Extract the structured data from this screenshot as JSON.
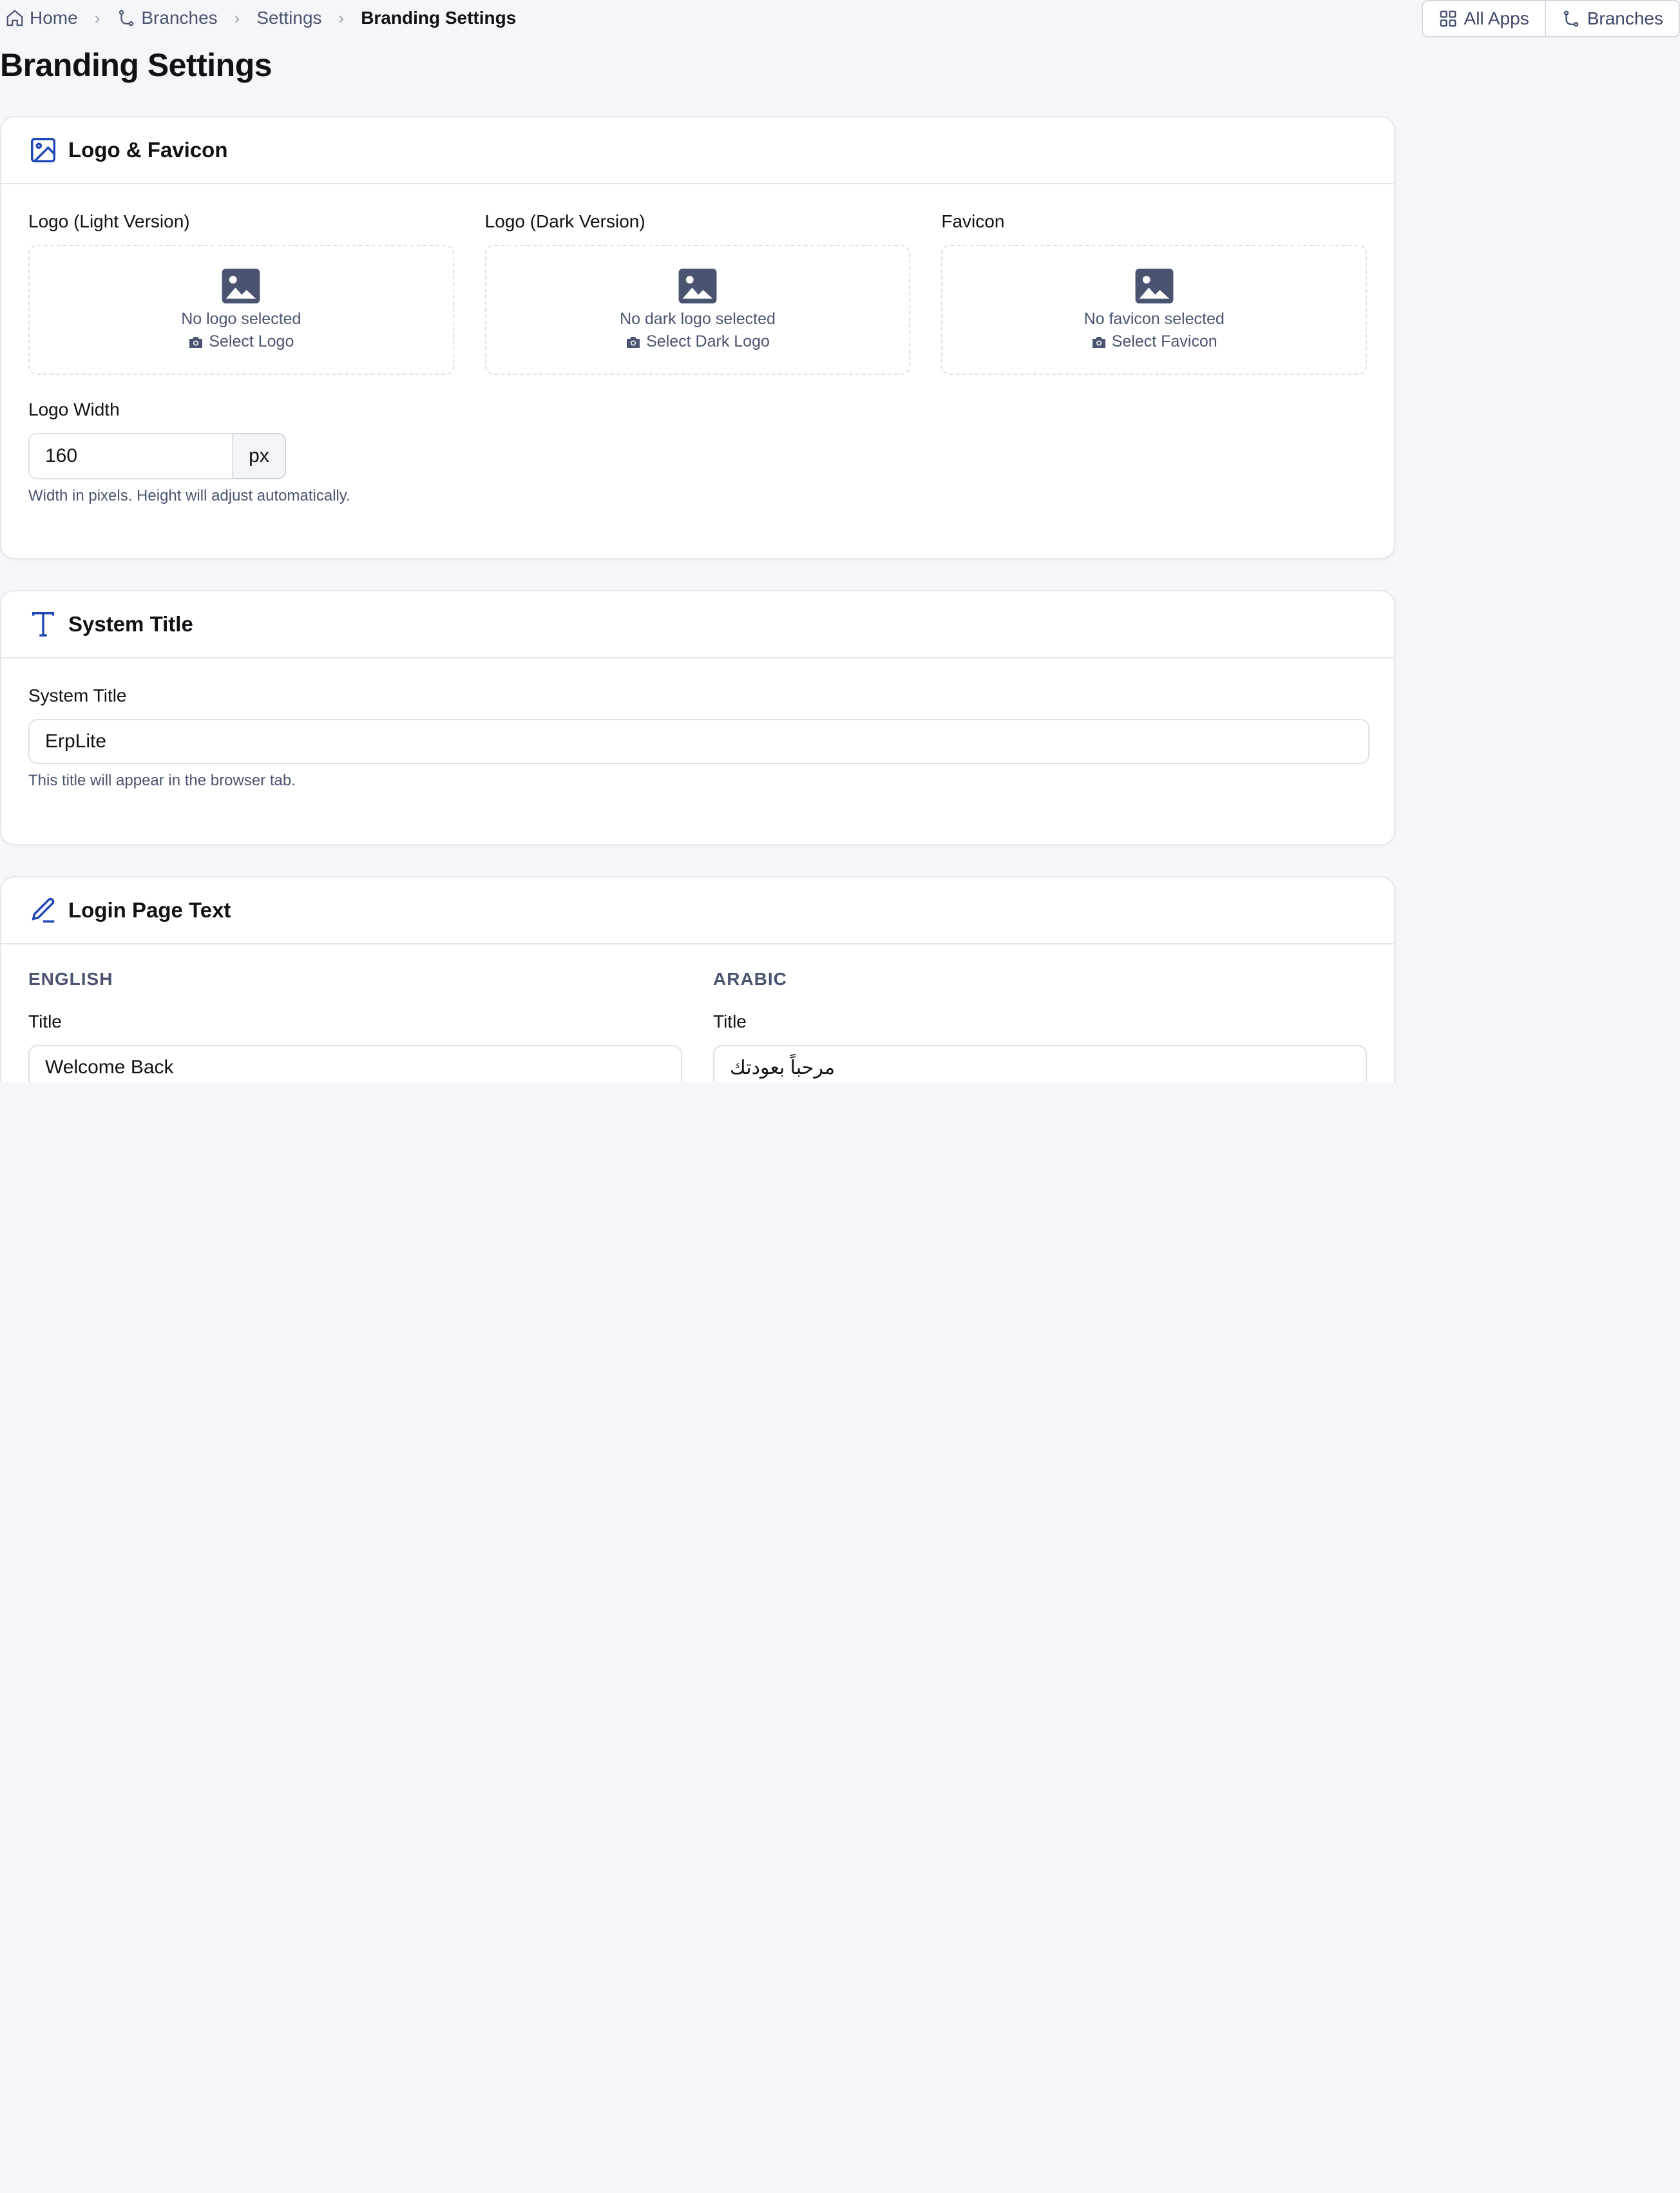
{
  "breadcrumb": {
    "home": "Home",
    "branches": "Branches",
    "settings": "Settings",
    "current": "Branding Settings",
    "separator": "›"
  },
  "top_buttons": {
    "all_apps": "All Apps",
    "branches": "Branches"
  },
  "page": {
    "title": "Branding Settings"
  },
  "logo_card": {
    "title": "Logo & Favicon",
    "uploads": [
      {
        "label": "Logo (Light Version)",
        "empty": "No logo selected",
        "action": "Select Logo"
      },
      {
        "label": "Logo (Dark Version)",
        "empty": "No dark logo selected",
        "action": "Select Dark Logo"
      },
      {
        "label": "Favicon",
        "empty": "No favicon selected",
        "action": "Select Favicon"
      }
    ],
    "width_label": "Logo Width",
    "width_value": "160",
    "width_unit": "px",
    "width_help": "Width in pixels. Height will adjust automatically."
  },
  "title_card": {
    "title": "System Title",
    "field_label": "System Title",
    "field_value": "ErpLite",
    "help": "This title will appear in the browser tab."
  },
  "login_card": {
    "title": "Login Page Text",
    "english": {
      "heading": "ENGLISH",
      "title_label": "Title",
      "title_value": "Welcome Back"
    },
    "arabic": {
      "heading": "ARABIC",
      "title_label": "Title",
      "title_value": "مرحباً بعودتك"
    }
  },
  "colors": {
    "accent": "#1f47b8",
    "background": "#f5f6fa",
    "muted_text": "#4a5470"
  }
}
